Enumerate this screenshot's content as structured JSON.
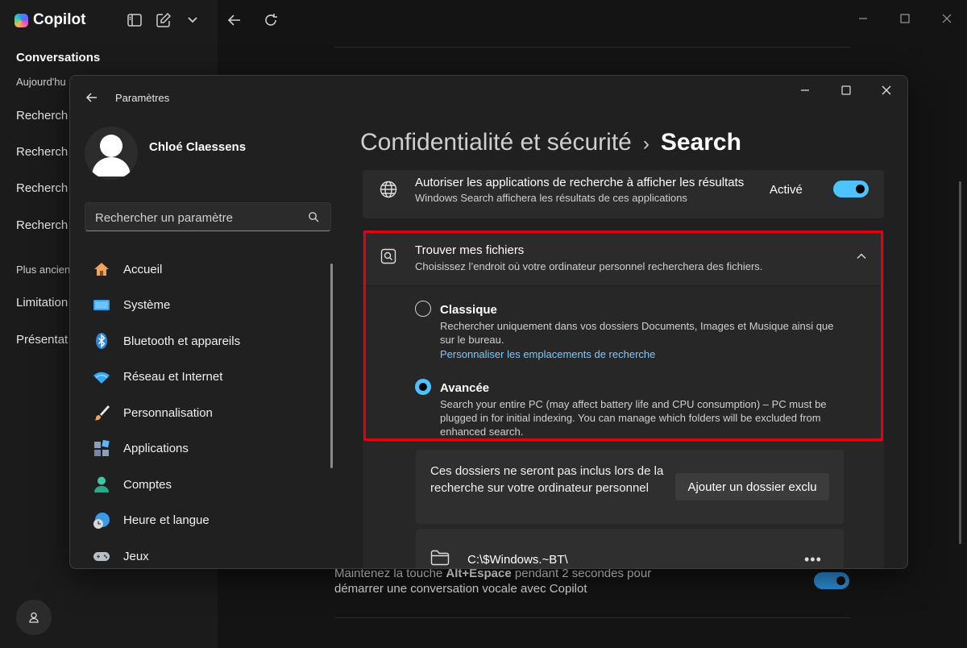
{
  "copilot": {
    "app_name": "Copilot",
    "conversations_title": "Conversations",
    "sections": [
      {
        "label": "Aujourd'hu"
      },
      {
        "label": "Plus ancien"
      }
    ],
    "items": [
      "Recherch",
      "Recherch",
      "Recherch",
      "Recherch",
      "Limitation",
      "Présentat"
    ],
    "voice_hint": {
      "before": "Maintenez la touche ",
      "shortcut": "Alt+Espace",
      "after": " pendant 2 secondes pour démarrer une conversation vocale avec Copilot"
    }
  },
  "settings": {
    "window_title": "Paramètres",
    "user_name": "Chloé Claessens",
    "search_placeholder": "Rechercher un paramètre",
    "nav": [
      {
        "label": "Accueil",
        "icon": "home-icon"
      },
      {
        "label": "Système",
        "icon": "system-icon"
      },
      {
        "label": "Bluetooth et appareils",
        "icon": "bluetooth-icon"
      },
      {
        "label": "Réseau et Internet",
        "icon": "wifi-icon"
      },
      {
        "label": "Personnalisation",
        "icon": "brush-icon"
      },
      {
        "label": "Applications",
        "icon": "apps-icon"
      },
      {
        "label": "Comptes",
        "icon": "account-icon"
      },
      {
        "label": "Heure et langue",
        "icon": "time-language-icon"
      },
      {
        "label": "Jeux",
        "icon": "gamepad-icon"
      }
    ],
    "breadcrumb": {
      "parent": "Confidentialité et sécurité",
      "separator": "›",
      "current": "Search"
    },
    "allow_apps": {
      "title": "Autoriser les applications de recherche à afficher les résultats",
      "subtitle": "Windows Search affichera les résultats de ces applications",
      "toggle_label": "Activé",
      "toggle_on": true
    },
    "find_files": {
      "title": "Trouver mes fichiers",
      "subtitle": "Choisissez l’endroit où votre ordinateur personnel recherchera des fichiers.",
      "expanded": true,
      "options": [
        {
          "title": "Classique",
          "desc": "Rechercher uniquement dans vos dossiers Documents, Images et Musique ainsi que sur le bureau.",
          "link": "Personnaliser les emplacements de recherche",
          "selected": false
        },
        {
          "title": "Avancée",
          "desc": "Search your entire PC (may affect battery life and CPU consumption) – PC must be plugged in for initial indexing. You can manage which folders will be excluded from enhanced search.",
          "selected": true
        }
      ]
    },
    "exclusions": {
      "text": "Ces dossiers ne seront pas inclus lors de la recherche sur votre ordinateur personnel",
      "button": "Ajouter un dossier exclu",
      "folders": [
        {
          "path": "C:\\$Windows.~BT\\",
          "more": "•••"
        }
      ]
    }
  },
  "colors": {
    "accent": "#4cc2ff",
    "highlight": "#e3000f",
    "copilot_toggle": "#2d8fd8"
  }
}
